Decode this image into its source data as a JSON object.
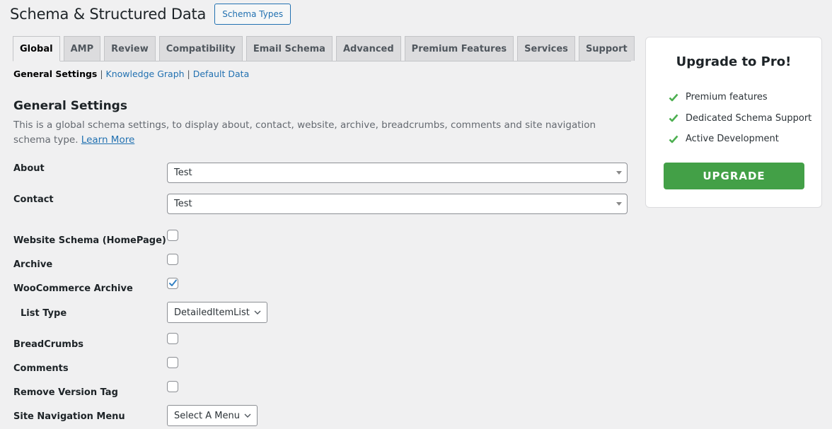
{
  "header": {
    "title": "Schema & Structured Data",
    "schema_types_button": "Schema Types"
  },
  "tabs": [
    {
      "label": "Global",
      "active": true
    },
    {
      "label": "AMP",
      "active": false
    },
    {
      "label": "Review",
      "active": false
    },
    {
      "label": "Compatibility",
      "active": false
    },
    {
      "label": "Email Schema",
      "active": false
    },
    {
      "label": "Advanced",
      "active": false
    },
    {
      "label": "Premium Features",
      "active": false
    },
    {
      "label": "Services",
      "active": false
    },
    {
      "label": "Support",
      "active": false
    }
  ],
  "subnav": {
    "current": "General Settings",
    "separator": " | ",
    "links": [
      "Knowledge Graph",
      "Default Data"
    ]
  },
  "section": {
    "title": "General Settings",
    "description": "This is a global schema settings, to display about, contact, website, archive, breadcrumbs, comments and site navigation schema type. ",
    "learn_more": "Learn More"
  },
  "fields": {
    "about": {
      "label": "About",
      "value": "Test"
    },
    "contact": {
      "label": "Contact",
      "value": "Test"
    },
    "website_schema": {
      "label": "Website Schema (HomePage)",
      "checked": false
    },
    "archive": {
      "label": "Archive",
      "checked": false
    },
    "woocommerce_archive": {
      "label": "WooCommerce Archive",
      "checked": true
    },
    "list_type": {
      "label": "List Type",
      "value": "DetailedItemList"
    },
    "breadcrumbs": {
      "label": "BreadCrumbs",
      "checked": false
    },
    "comments": {
      "label": "Comments",
      "checked": false
    },
    "remove_version_tag": {
      "label": "Remove Version Tag",
      "checked": false
    },
    "site_navigation_menu": {
      "label": "Site Navigation Menu",
      "value": "Select A Menu"
    }
  },
  "upgrade_card": {
    "title": "Upgrade to Pro!",
    "features": [
      "Premium features",
      "Dedicated Schema Support",
      "Active Development"
    ],
    "button": "UPGRADE",
    "accent_color": "#43a047",
    "check_color": "#4caf50"
  },
  "colors": {
    "link": "#2271b1",
    "background": "#f0f0f1"
  }
}
